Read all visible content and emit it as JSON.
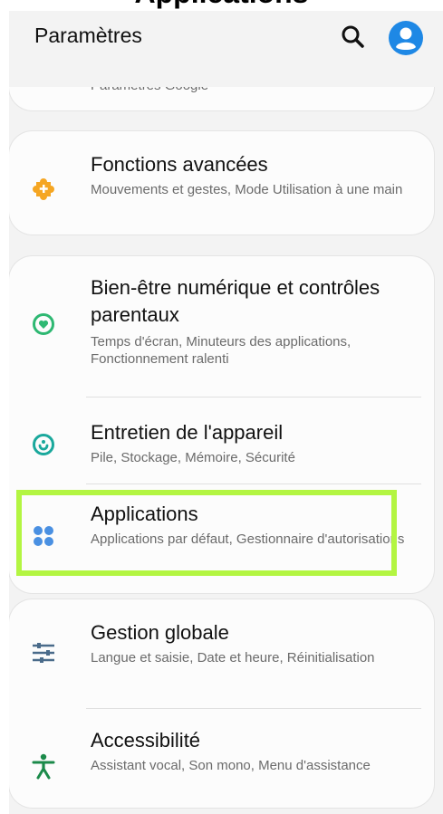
{
  "caption": {
    "text": "Applications"
  },
  "header": {
    "title": "Paramètres",
    "search_icon": "search-icon",
    "account_icon": "account-icon"
  },
  "items": {
    "google": {
      "subtitle": "Paramètres Google"
    },
    "advanced": {
      "title": "Fonctions avancées",
      "subtitle": "Mouvements et gestes, Mode Utilisation à une main",
      "icon": "puzzle-plus-icon",
      "color": "#f5a623"
    },
    "wellbeing": {
      "title": "Bien-être numérique et contrôles parentaux",
      "subtitle": "Temps d'écran, Minuteurs des applications, Fonctionnement ralenti",
      "icon": "heart-circle-icon",
      "color": "#2eb872"
    },
    "device_care": {
      "title": "Entretien de l'appareil",
      "subtitle": "Pile, Stockage, Mémoire, Sécurité",
      "icon": "device-care-icon",
      "color": "#1aa89c"
    },
    "applications": {
      "title": "Applications",
      "subtitle": "Applications par défaut, Gestionnaire d'autorisations",
      "icon": "apps-dots-icon",
      "color": "#4a90e2"
    },
    "general": {
      "title": "Gestion globale",
      "subtitle": "Langue et saisie, Date et heure, Réinitialisation",
      "icon": "sliders-icon",
      "color": "#4a6b8a"
    },
    "accessibility": {
      "title": "Accessibilité",
      "subtitle": "Assistant vocal, Son mono, Menu d'assistance",
      "icon": "accessibility-icon",
      "color": "#1b8a4a"
    }
  },
  "highlight_color": "#b3f542"
}
